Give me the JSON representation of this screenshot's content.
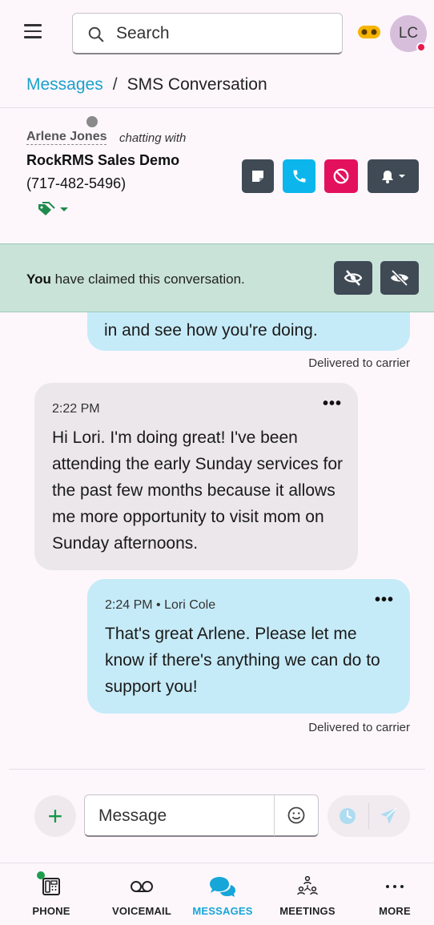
{
  "header": {
    "search_placeholder": "Search",
    "avatar_initials": "LC"
  },
  "breadcrumb": {
    "parent": "Messages",
    "separator": "/",
    "current": "SMS Conversation"
  },
  "contact": {
    "name": "Arlene Jones",
    "chatting_with": "chatting with",
    "group": "RockRMS Sales Demo",
    "phone": "(717-482-5496)"
  },
  "claim": {
    "who": "You",
    "text": " have claimed this conversation."
  },
  "messages": [
    {
      "direction": "outgoing",
      "body": "in and see how you're doing.",
      "status": "Delivered to carrier"
    },
    {
      "direction": "incoming",
      "meta": "2:22 PM",
      "menu": "•••",
      "body": "Hi Lori. I'm doing great! I've been attending the early Sunday services for the past few months because it allows me more opportunity to visit mom on Sunday afternoons."
    },
    {
      "direction": "outgoing",
      "meta": "2:24 PM • Lori Cole",
      "menu": "•••",
      "body": "That's great Arlene. Please let me know if there's anything we can do to support you!",
      "status": "Delivered to carrier"
    }
  ],
  "composer": {
    "placeholder": "Message",
    "add_symbol": "+"
  },
  "nav": [
    {
      "label": "PHONE",
      "icon": "phone-dialpad-icon"
    },
    {
      "label": "VOICEMAIL",
      "icon": "voicemail-icon"
    },
    {
      "label": "MESSAGES",
      "icon": "chat-bubbles-icon",
      "active": true
    },
    {
      "label": "MEETINGS",
      "icon": "meetings-icon"
    },
    {
      "label": "MORE",
      "icon": "more-dots-icon"
    }
  ],
  "colors": {
    "accent": "#17a6d8",
    "call_button": "#0cb6ec",
    "block_button": "#e3115d",
    "dark_button": "#3f4a55",
    "claim_bar": "#c9e3d8",
    "outgoing_bubble": "#c6ebf8",
    "incoming_bubble": "#ebe7ea"
  }
}
